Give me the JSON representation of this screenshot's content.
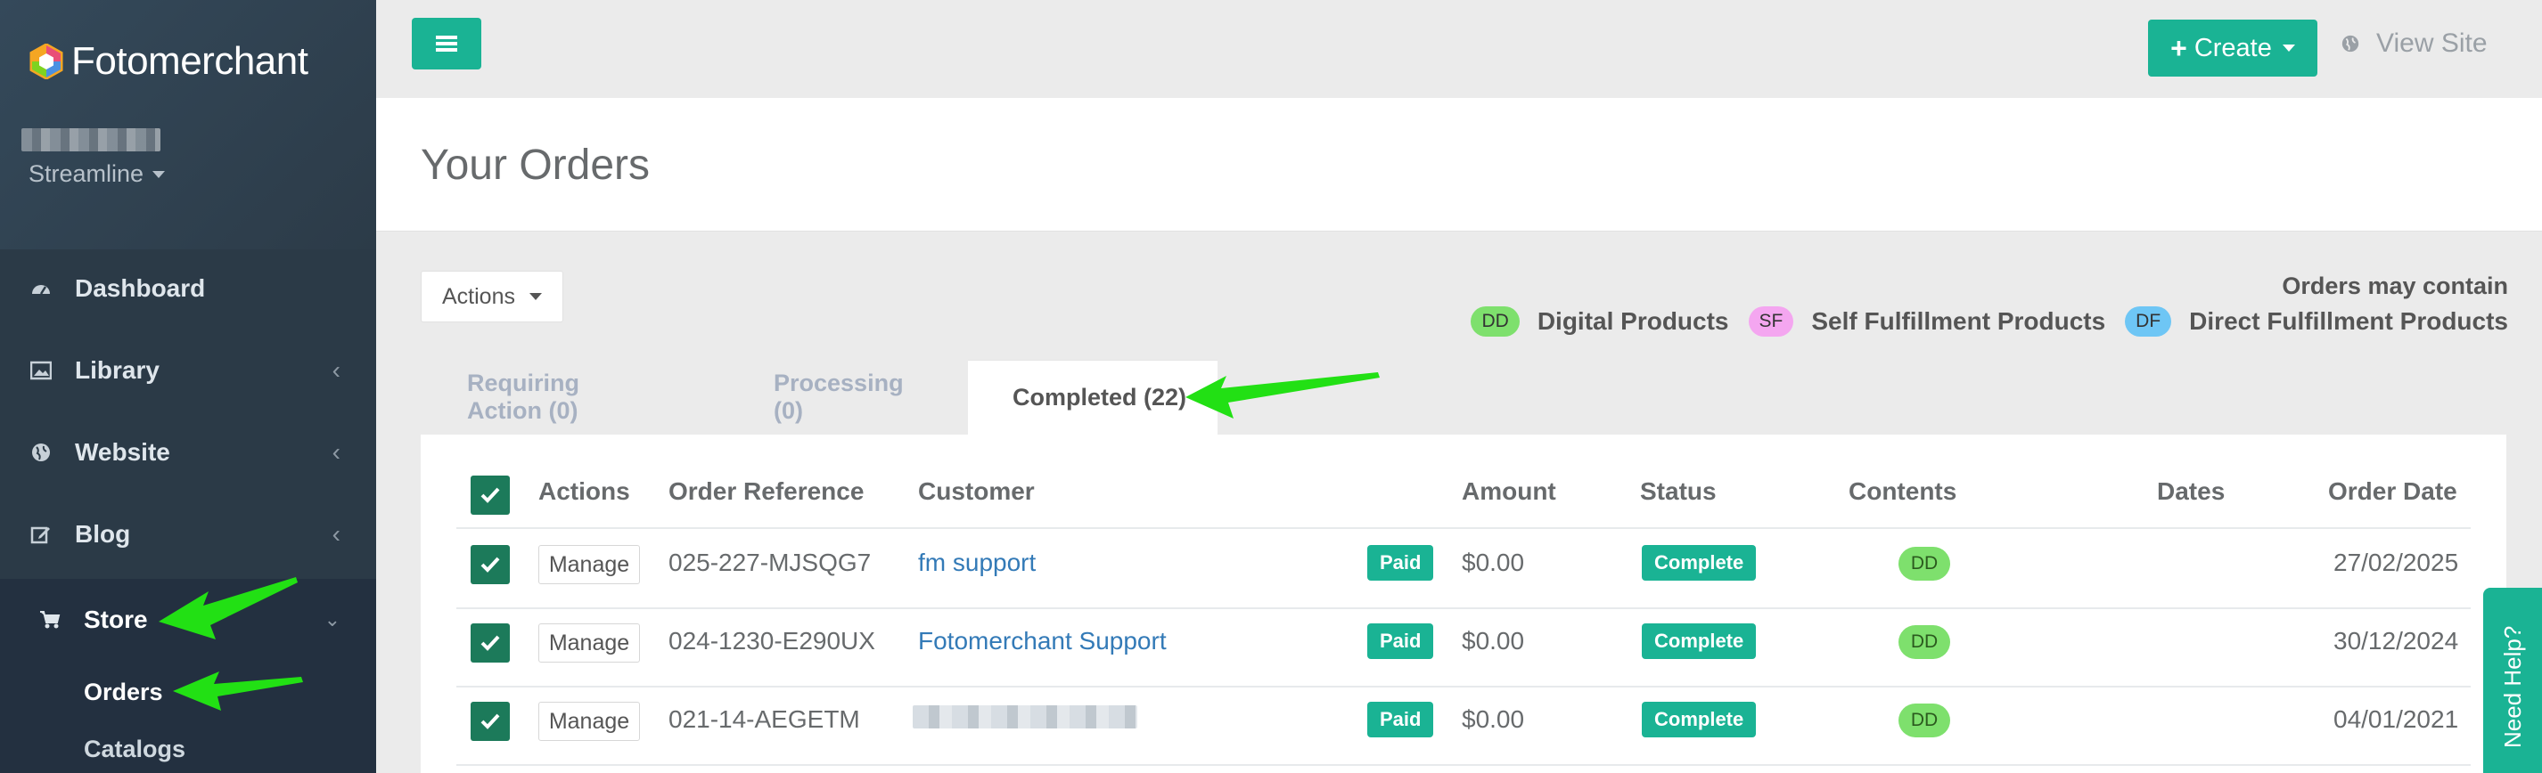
{
  "brand": {
    "name": "Fotomerchant"
  },
  "workspace": {
    "label": "Streamline"
  },
  "sidebar": {
    "items": [
      {
        "label": "Dashboard",
        "icon": "dashboard-icon"
      },
      {
        "label": "Library",
        "icon": "image-icon"
      },
      {
        "label": "Website",
        "icon": "globe-icon"
      },
      {
        "label": "Blog",
        "icon": "edit-icon"
      },
      {
        "label": "Store",
        "icon": "cart-icon"
      }
    ],
    "sub_items": [
      {
        "label": "Orders"
      },
      {
        "label": "Catalogs"
      }
    ]
  },
  "topbar": {
    "create_label": "Create",
    "view_site_label": "View Site"
  },
  "page": {
    "title": "Your Orders"
  },
  "actions_dropdown": {
    "label": "Actions"
  },
  "legend": {
    "title": "Orders may contain",
    "items": [
      {
        "code": "DD",
        "label": "Digital Products",
        "color": "#7ee06d"
      },
      {
        "code": "SF",
        "label": "Self Fulfillment Products",
        "color": "#f4a6f0"
      },
      {
        "code": "DF",
        "label": "Direct Fulfillment Products",
        "color": "#6ec6f5"
      }
    ]
  },
  "tabs": [
    {
      "label": "Requiring Action (0)"
    },
    {
      "label": "Processing (0)"
    },
    {
      "label": "Completed (22)"
    }
  ],
  "table": {
    "headers": [
      "Actions",
      "Order Reference",
      "Customer",
      "Amount",
      "Status",
      "Contents",
      "Dates",
      "Order Date"
    ],
    "rows": [
      {
        "action": "Manage",
        "reference": "025-227-MJSQG7",
        "customer": "fm support",
        "payment": "Paid",
        "amount": "$0.00",
        "status": "Complete",
        "contents": "DD",
        "order_date": "27/02/2025"
      },
      {
        "action": "Manage",
        "reference": "024-1230-E290UX",
        "customer": "Fotomerchant Support",
        "payment": "Paid",
        "amount": "$0.00",
        "status": "Complete",
        "contents": "DD",
        "order_date": "30/12/2024"
      },
      {
        "action": "Manage",
        "reference": "021-14-AEGETM",
        "customer": "",
        "payment": "Paid",
        "amount": "$0.00",
        "status": "Complete",
        "contents": "DD",
        "order_date": "04/01/2021"
      }
    ]
  },
  "help": {
    "label": "Need Help?"
  },
  "colors": {
    "accent": "#1ab394",
    "sidebar": "#2b3a47",
    "annotation_arrow": "#22e014"
  }
}
